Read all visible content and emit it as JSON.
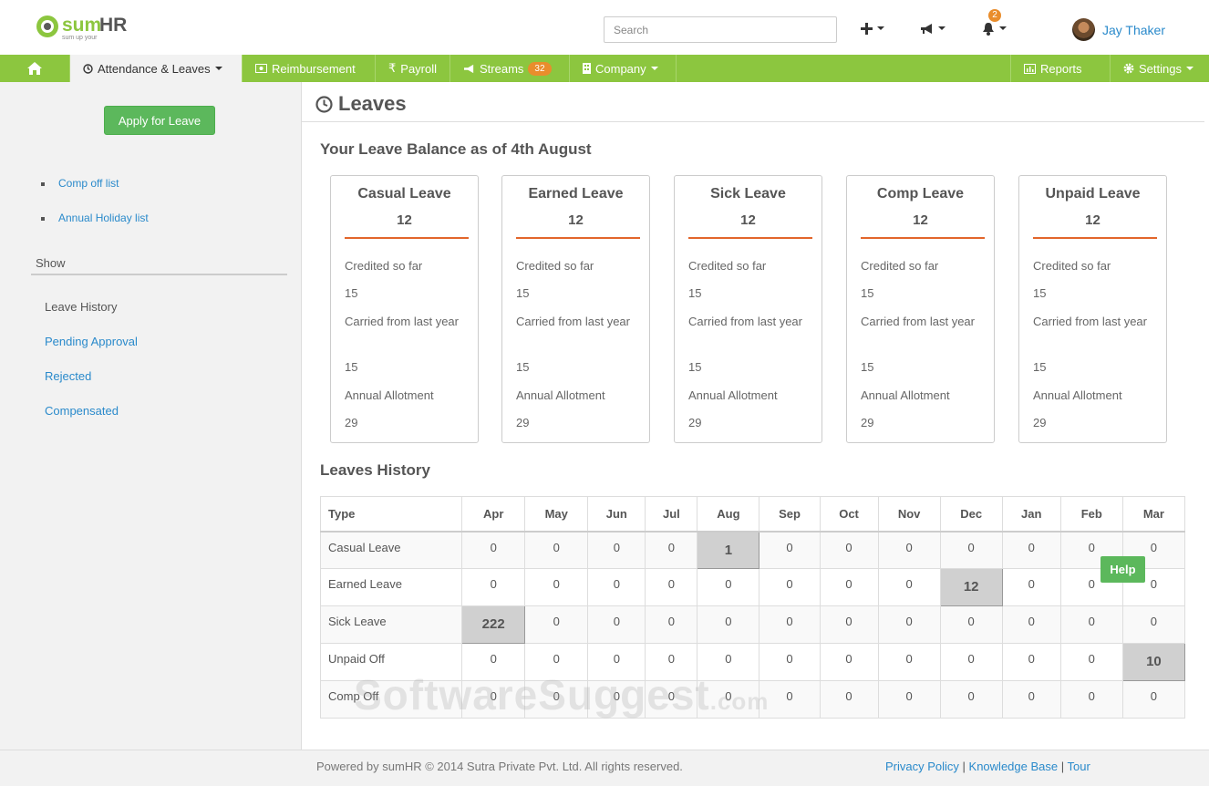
{
  "brand": {
    "logo_main": "sumHR",
    "logo_tagline": "sum up your HR"
  },
  "header": {
    "search_placeholder": "Search",
    "notification_count": "2",
    "user_name": "Jay Thaker"
  },
  "nav": {
    "items": [
      {
        "label": "Attendance & Leaves"
      },
      {
        "label": "Reimbursement"
      },
      {
        "label": "Payroll"
      },
      {
        "label": "Streams",
        "badge": "32"
      },
      {
        "label": "Company"
      }
    ],
    "right": [
      {
        "label": "Reports"
      },
      {
        "label": "Settings"
      }
    ]
  },
  "sidebar": {
    "apply_button": "Apply for Leave",
    "links": [
      "Comp off list",
      "Annual Holiday list"
    ],
    "show_heading": "Show",
    "show_items": [
      "Leave History",
      "Pending Approval",
      "Rejected",
      "Compensated"
    ]
  },
  "main": {
    "title": "Leaves",
    "balance_title": "Your Leave Balance as of 4th August",
    "labels": {
      "credited": "Credited so far",
      "carried": "Carried from last year",
      "annual": "Annual Allotment"
    },
    "cards": [
      {
        "name": "Casual Leave",
        "total": "12",
        "credited": "15",
        "carried": "15",
        "annual": "29"
      },
      {
        "name": "Earned Leave",
        "total": "12",
        "credited": "15",
        "carried": "15",
        "annual": "29"
      },
      {
        "name": "Sick Leave",
        "total": "12",
        "credited": "15",
        "carried": "15",
        "annual": "29"
      },
      {
        "name": "Comp Leave",
        "total": "12",
        "credited": "15",
        "carried": "15",
        "annual": "29"
      },
      {
        "name": "Unpaid Leave",
        "total": "12",
        "credited": "15",
        "carried": "15",
        "annual": "29"
      }
    ],
    "history_title": "Leaves History",
    "history": {
      "type_header": "Type",
      "months": [
        "Apr",
        "May",
        "Jun",
        "Jul",
        "Aug",
        "Sep",
        "Oct",
        "Nov",
        "Dec",
        "Jan",
        "Feb",
        "Mar"
      ],
      "rows": [
        {
          "type": "Casual Leave",
          "values": [
            "0",
            "0",
            "0",
            "0",
            "1",
            "0",
            "0",
            "0",
            "0",
            "0",
            "0",
            "0"
          ]
        },
        {
          "type": "Earned Leave",
          "values": [
            "0",
            "0",
            "0",
            "0",
            "0",
            "0",
            "0",
            "0",
            "12",
            "0",
            "0",
            "0"
          ]
        },
        {
          "type": "Sick Leave",
          "values": [
            "222",
            "0",
            "0",
            "0",
            "0",
            "0",
            "0",
            "0",
            "0",
            "0",
            "0",
            "0"
          ]
        },
        {
          "type": "Unpaid Off",
          "values": [
            "0",
            "0",
            "0",
            "0",
            "0",
            "0",
            "0",
            "0",
            "0",
            "0",
            "0",
            "10"
          ]
        },
        {
          "type": "Comp Off",
          "values": [
            "0",
            "0",
            "0",
            "0",
            "0",
            "0",
            "0",
            "0",
            "0",
            "0",
            "0",
            "0"
          ]
        }
      ]
    },
    "help_button": "Help",
    "watermark": "SoftwareSuggest",
    "watermark_suffix": ".com"
  },
  "footer": {
    "copyright": "Powered by sumHR © 2014 Sutra Private Pvt. Ltd. All rights reserved.",
    "links": [
      "Privacy Policy",
      "Knowledge Base",
      "Tour"
    ]
  },
  "colors": {
    "nav_green": "#8cc63f",
    "accent_orange": "#e2662b",
    "badge_orange": "#e98d2c",
    "button_green": "#5cb85c",
    "link_blue": "#2a8acb"
  }
}
